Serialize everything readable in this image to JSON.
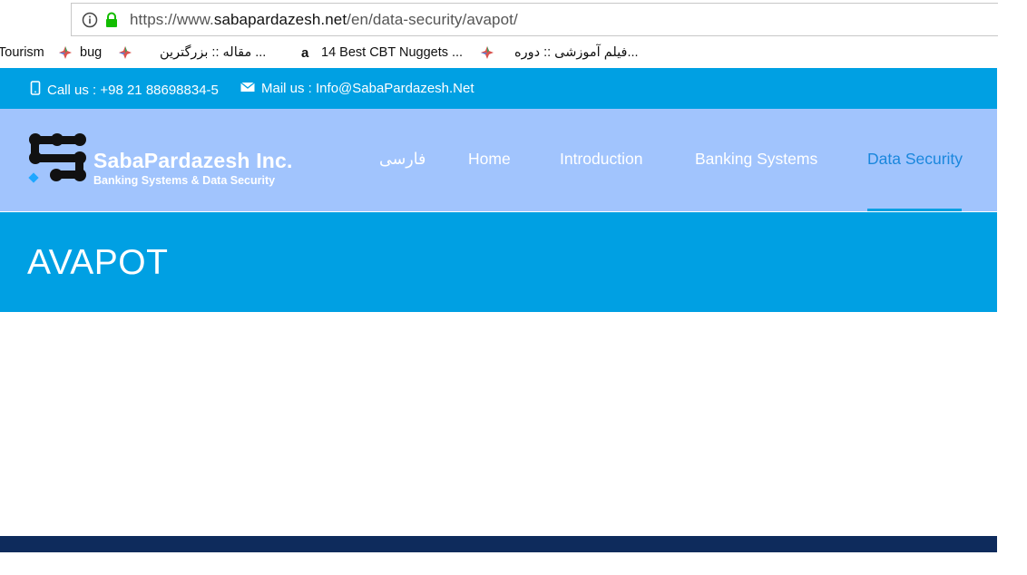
{
  "browser": {
    "url_scheme": "https://www.",
    "url_domain": "sabapardazesh.net",
    "url_path": "/en/data-security/avapot/"
  },
  "bookmarks": [
    {
      "label": "Tourism"
    },
    {
      "label": "bug"
    },
    {
      "label": "مقاله :: بزرگترین ..."
    },
    {
      "label": "14 Best CBT Nuggets ..."
    },
    {
      "label": "فیلم آموزشی :: دوره..."
    }
  ],
  "topbar": {
    "phone": "Call us : +98 21 88698834-5",
    "mail": "Mail us : Info@SabaPardazesh.Net"
  },
  "brand": {
    "name": "SabaPardazesh Inc.",
    "tagline": "Banking Systems & Data Security"
  },
  "nav": {
    "items": [
      {
        "label": "فارسی"
      },
      {
        "label": "Home"
      },
      {
        "label": "Introduction"
      },
      {
        "label": "Banking Systems"
      },
      {
        "label": "Data Security"
      }
    ],
    "active": "Data Security"
  },
  "page": {
    "title": "AVAPOT"
  },
  "colors": {
    "accent_blue": "#00a0e3",
    "nav_bg": "#a1c4fd",
    "active_nav": "#1a87dd",
    "footer": "#0e2b5c"
  }
}
